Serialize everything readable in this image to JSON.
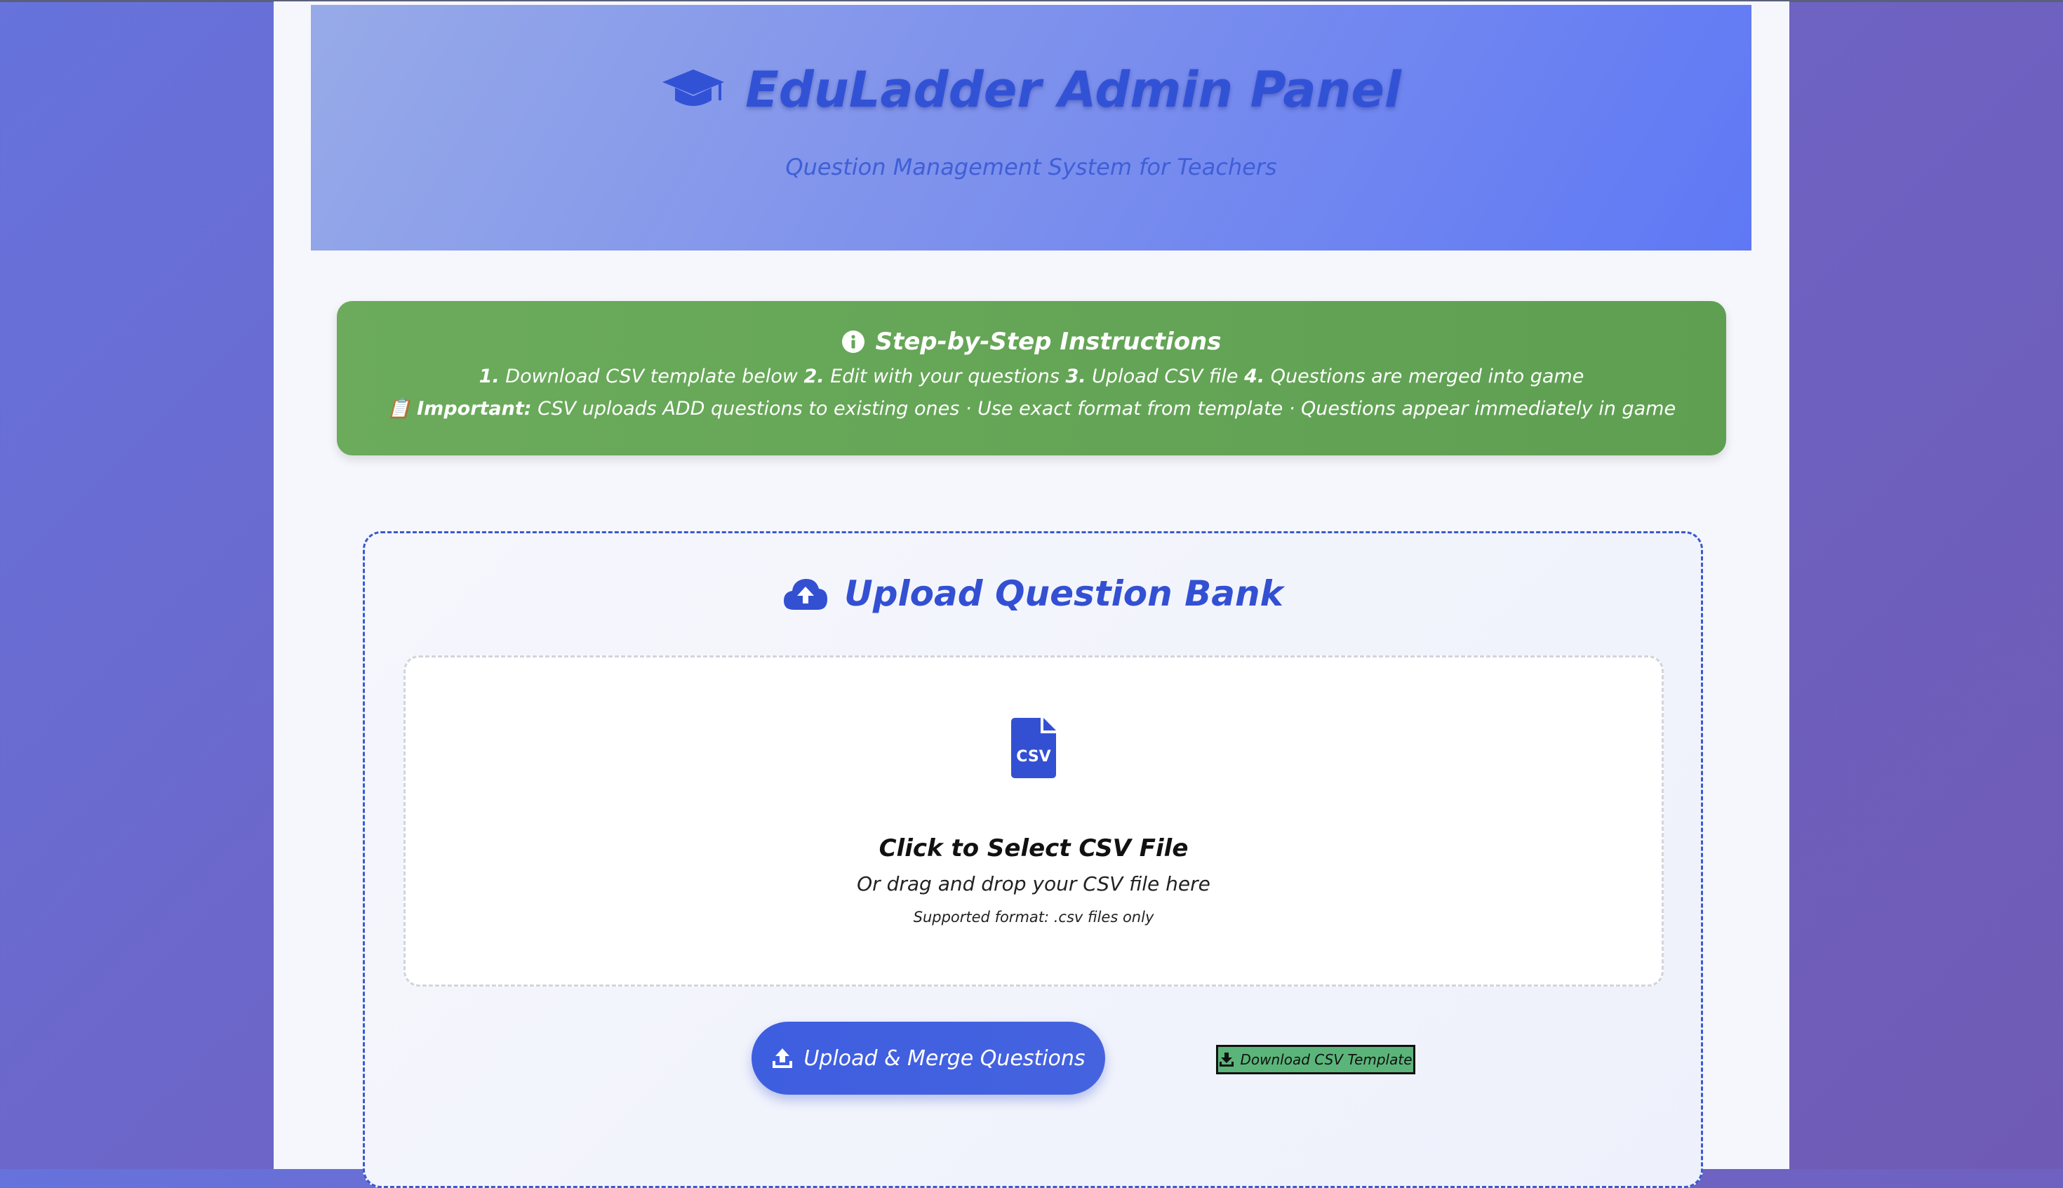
{
  "header": {
    "title": "EduLadder Admin Panel",
    "subtitle": "Question Management System for Teachers",
    "icon": "graduation-cap-icon",
    "title_color": "#3252d6"
  },
  "instructions": {
    "title": "Step-by-Step Instructions",
    "icon": "info-circle-icon",
    "steps": [
      {
        "num": "1.",
        "text": "Download CSV template below"
      },
      {
        "num": "2.",
        "text": "Edit with your questions"
      },
      {
        "num": "3.",
        "text": "Upload CSV file"
      },
      {
        "num": "4.",
        "text": "Questions are merged into game"
      }
    ],
    "important_emoji": "📋",
    "important_label": "Important:",
    "important_text": "CSV uploads ADD questions to existing ones · Use exact format from template · Questions appear immediately in game",
    "bg_color": "#65a757"
  },
  "upload": {
    "title": "Upload Question Bank",
    "icon": "cloud-upload-icon",
    "accent_color": "#3350d3",
    "dropzone": {
      "icon": "csv-file-icon",
      "icon_text": "CSV",
      "title": "Click to Select CSV File",
      "subtitle": "Or drag and drop your CSV file here",
      "note": "Supported format: .csv files only"
    },
    "upload_button": "Upload & Merge Questions",
    "template_button": "Download CSV Template"
  }
}
